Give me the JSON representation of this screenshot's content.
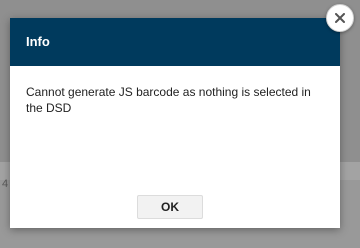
{
  "background": {
    "partial_text": "4"
  },
  "dialog": {
    "title": "Info",
    "message": "Cannot generate JS barcode as nothing is selected in the DSD",
    "ok_label": "OK",
    "close_icon": "close-icon"
  },
  "colors": {
    "header": "#003a5d",
    "header_text": "#ffffff",
    "overlay": "#8f8f8f"
  }
}
